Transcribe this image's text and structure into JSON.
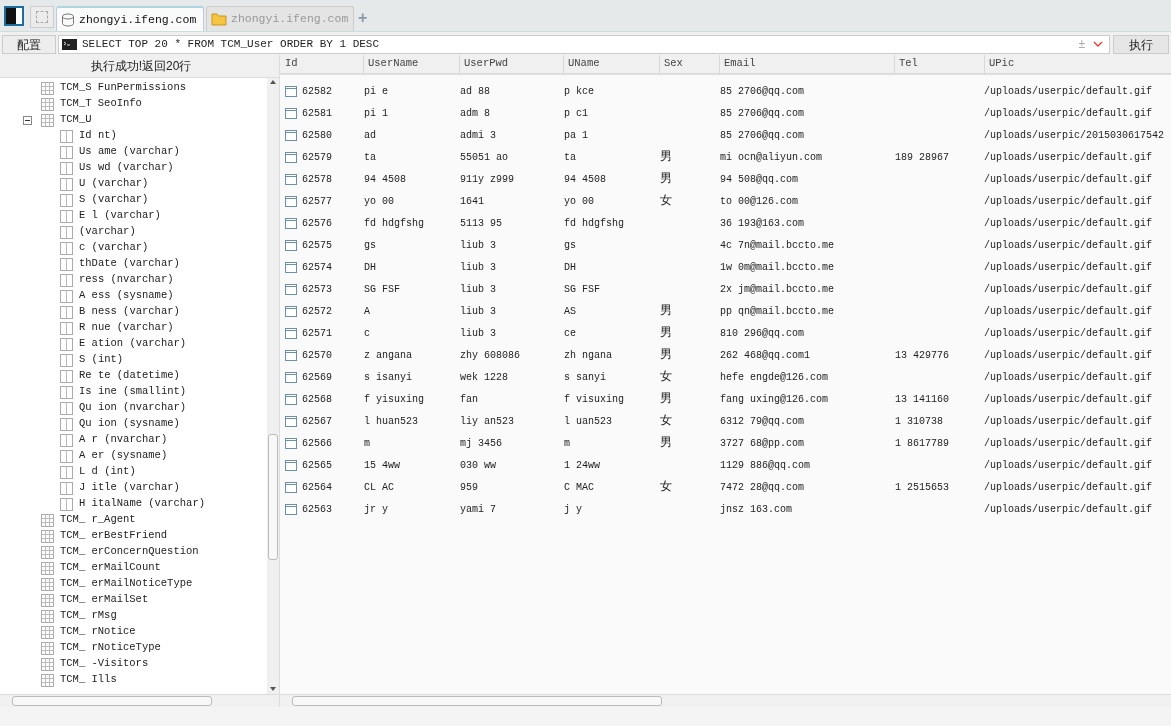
{
  "tabs": [
    {
      "label": "zhongyi.ifeng.com",
      "kind": "database",
      "selected": true
    },
    {
      "label": "zhongyi.ifeng.com",
      "kind": "folder",
      "selected": false
    }
  ],
  "new_tab": "+",
  "toolbar": {
    "config_button": "配置",
    "query": "SELECT TOP 20 * FROM TCM_User ORDER BY 1 DESC",
    "history_symbol": "±",
    "run_button": "执行"
  },
  "status_message": "执行成功!返回20行",
  "tree": [
    {
      "label": "TCM_S FunPermissions",
      "expanded": false
    },
    {
      "label": "TCM_T SeoInfo",
      "expanded": false
    },
    {
      "label": "TCM_U",
      "expanded": true,
      "children": [
        "Id nt)",
        "Us ame (varchar)",
        "Us wd (varchar)",
        "U (varchar)",
        "S (varchar)",
        "E l (varchar)",
        "(varchar)",
        "c (varchar)",
        "thDate (varchar)",
        "ress (nvarchar)",
        "A ess (sysname)",
        "B ness (varchar)",
        "R nue (varchar)",
        "E ation (varchar)",
        "S (int)",
        "Re te (datetime)",
        "Is ine (smallint)",
        "Qu ion (nvarchar)",
        "Qu ion (sysname)",
        "A r (nvarchar)",
        "A er (sysname)",
        "L d (int)",
        "J itle (varchar)",
        "H italName (varchar)"
      ]
    },
    {
      "label": "TCM_ r_Agent",
      "expanded": false
    },
    {
      "label": "TCM_ erBestFriend",
      "expanded": false
    },
    {
      "label": "TCM_ erConcernQuestion",
      "expanded": false
    },
    {
      "label": "TCM_ erMailCount",
      "expanded": false
    },
    {
      "label": "TCM_ erMailNoticeType",
      "expanded": false
    },
    {
      "label": "TCM_ erMailSet",
      "expanded": false
    },
    {
      "label": "TCM_ rMsg",
      "expanded": false
    },
    {
      "label": "TCM_ rNotice",
      "expanded": false
    },
    {
      "label": "TCM_ rNoticeType",
      "expanded": false
    },
    {
      "label": "TCM_ -Visitors",
      "expanded": false
    },
    {
      "label": "TCM_ Ills",
      "expanded": false
    }
  ],
  "table": {
    "columns": [
      "Id",
      "UserName",
      "UserPwd",
      "UName",
      "Sex",
      "Email",
      "Tel",
      "UPic"
    ],
    "rows": [
      {
        "id": "62582",
        "username": "pi e",
        "userpwd": "ad 88",
        "uname": "p kce",
        "email": "85 2706@qq.com",
        "upic": "/uploads/userpic/default.gif"
      },
      {
        "id": "62581",
        "username": "pi 1",
        "userpwd": "adm 8",
        "uname": "p c1",
        "email": "85 2706@qq.com",
        "upic": "/uploads/userpic/default.gif"
      },
      {
        "id": "62580",
        "username": "ad",
        "userpwd": "admi 3",
        "uname": "pa 1",
        "email": "85 2706@qq.com",
        "upic": "/uploads/userpic/2015030617542"
      },
      {
        "id": "62579",
        "username": "ta",
        "userpwd": "55051 ao",
        "uname": "ta",
        "sex": "男",
        "email": "mi ocn@aliyun.com",
        "tel": "189 28967",
        "upic": "/uploads/userpic/default.gif"
      },
      {
        "id": "62578",
        "username": "94 4508",
        "userpwd": "911y z999",
        "uname": "94 4508",
        "sex": "男",
        "email": "94 508@qq.com",
        "upic": "/uploads/userpic/default.gif"
      },
      {
        "id": "62577",
        "username": "yo 00",
        "userpwd": "1641",
        "uname": "yo 00",
        "sex": "女",
        "email": "to 00@126.com",
        "upic": "/uploads/userpic/default.gif"
      },
      {
        "id": "62576",
        "username": "fd hdgfshg",
        "userpwd": "5113 95",
        "uname": "fd hdgfshg",
        "email": "36 193@163.com",
        "upic": "/uploads/userpic/default.gif"
      },
      {
        "id": "62575",
        "username": "gs",
        "userpwd": "liub 3",
        "uname": "gs",
        "email": "4c 7n@mail.bccto.me",
        "upic": "/uploads/userpic/default.gif"
      },
      {
        "id": "62574",
        "username": "DH",
        "userpwd": "liub 3",
        "uname": "DH",
        "email": "1w 0m@mail.bccto.me",
        "upic": "/uploads/userpic/default.gif"
      },
      {
        "id": "62573",
        "username": "SG FSF",
        "userpwd": "liub 3",
        "uname": "SG FSF",
        "email": "2x jm@mail.bccto.me",
        "upic": "/uploads/userpic/default.gif"
      },
      {
        "id": "62572",
        "username": "A",
        "userpwd": "liub 3",
        "uname": "AS",
        "sex": "男",
        "email": "pp qn@mail.bccto.me",
        "upic": "/uploads/userpic/default.gif"
      },
      {
        "id": "62571",
        "username": "c",
        "userpwd": "liub 3",
        "uname": "ce",
        "sex": "男",
        "email": "810 296@qq.com",
        "upic": "/uploads/userpic/default.gif"
      },
      {
        "id": "62570",
        "username": "z angana",
        "userpwd": "zhy 608086",
        "uname": "zh ngana",
        "sex": "男",
        "email": "262 468@qq.com1",
        "tel": "13 429776",
        "upic": "/uploads/userpic/default.gif"
      },
      {
        "id": "62569",
        "username": "s isanyi",
        "userpwd": "wek 1228",
        "uname": "s sanyi",
        "sex": "女",
        "email": "hefe engde@126.com",
        "upic": "/uploads/userpic/default.gif"
      },
      {
        "id": "62568",
        "username": "f yisuxing",
        "userpwd": "fan",
        "uname": "f visuxing",
        "sex": "男",
        "email": "fang uxing@126.com",
        "tel": "13 141160",
        "upic": "/uploads/userpic/default.gif"
      },
      {
        "id": "62567",
        "username": "l huan523",
        "userpwd": "liy an523",
        "uname": "l uan523",
        "sex": "女",
        "email": "6312 79@qq.com",
        "tel": "1 310738",
        "upic": "/uploads/userpic/default.gif"
      },
      {
        "id": "62566",
        "username": "m",
        "userpwd": "mj 3456",
        "uname": "m",
        "sex": "男",
        "email": "3727 68@pp.com",
        "tel": "1 8617789",
        "upic": "/uploads/userpic/default.gif"
      },
      {
        "id": "62565",
        "username": "15 4ww",
        "userpwd": "030 ww",
        "uname": "1 24ww",
        "email": "1129 886@qq.com",
        "upic": "/uploads/userpic/default.gif"
      },
      {
        "id": "62564",
        "username": "CL AC",
        "userpwd": "959",
        "uname": "C MAC",
        "sex": "女",
        "email": "7472 28@qq.com",
        "tel": "1 2515653",
        "upic": "/uploads/userpic/default.gif"
      },
      {
        "id": "62563",
        "username": "jr y",
        "userpwd": "yami 7",
        "uname": "j y",
        "email": "jnsz 163.com",
        "upic": "/uploads/userpic/default.gif"
      }
    ]
  }
}
